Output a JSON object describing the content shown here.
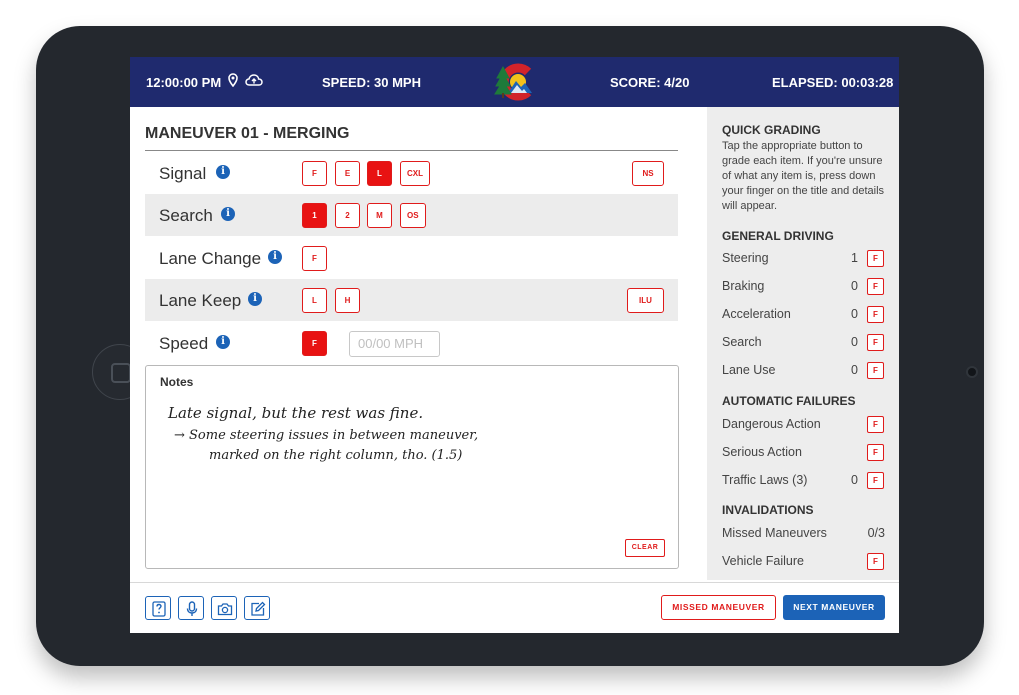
{
  "header": {
    "time": "12:00:00 PM",
    "speed": "SPEED: 30 MPH",
    "score": "SCORE: 4/20",
    "elapsed": "ELAPSED: 00:03:28",
    "bar_color": "#1f2a6e"
  },
  "maneuver": {
    "title": "MANEUVER 01 - MERGING",
    "rows": [
      {
        "label": "Signal",
        "buttons": [
          "F",
          "E",
          "L",
          "CXL"
        ],
        "active": "L",
        "extra": "NS"
      },
      {
        "label": "Search",
        "buttons": [
          "1",
          "2",
          "M",
          "OS"
        ],
        "active": "1"
      },
      {
        "label": "Lane Change",
        "buttons": [
          "F"
        ]
      },
      {
        "label": "Lane Keep",
        "buttons": [
          "L",
          "H"
        ],
        "extra": "ILU"
      },
      {
        "label": "Speed",
        "buttons": [
          "F"
        ],
        "active": "F",
        "input_placeholder": "00/00 MPH"
      }
    ]
  },
  "notes": {
    "label": "Notes",
    "lines": [
      "Late signal, but the rest was fine.",
      "→ Some steering issues in between maneuver,",
      "marked on the right column, tho. (1.5)"
    ],
    "clear_label": "CLEAR"
  },
  "sidebar": {
    "quick_title": "QUICK GRADING",
    "quick_desc": "Tap the appropriate button to grade each item. If you're unsure of what any item is, press down your finger on the title and details will appear.",
    "general_title": "GENERAL DRIVING",
    "general": [
      {
        "label": "Steering",
        "count": "1",
        "btn": "F"
      },
      {
        "label": "Braking",
        "count": "0",
        "btn": "F"
      },
      {
        "label": "Acceleration",
        "count": "0",
        "btn": "F"
      },
      {
        "label": "Search",
        "count": "0",
        "btn": "F"
      },
      {
        "label": "Lane Use",
        "count": "0",
        "btn": "F"
      }
    ],
    "auto_title": "AUTOMATIC FAILURES",
    "auto": [
      {
        "label": "Dangerous Action",
        "btn": "F"
      },
      {
        "label": "Serious Action",
        "btn": "F"
      },
      {
        "label": "Traffic Laws (3)",
        "count": "0",
        "btn": "F"
      }
    ],
    "inval_title": "INVALIDATIONS",
    "inval": [
      {
        "label": "Missed Maneuvers",
        "count": "0/3"
      },
      {
        "label": "Vehicle Failure",
        "btn": "F"
      }
    ]
  },
  "footer": {
    "tools": [
      "help-icon",
      "microphone-icon",
      "camera-icon",
      "edit-icon"
    ],
    "missed_label": "MISSED MANEUVER",
    "next_label": "NEXT MANEUVER"
  },
  "colors": {
    "accent_red": "#e01b1b",
    "primary_blue": "#1c63b7"
  }
}
